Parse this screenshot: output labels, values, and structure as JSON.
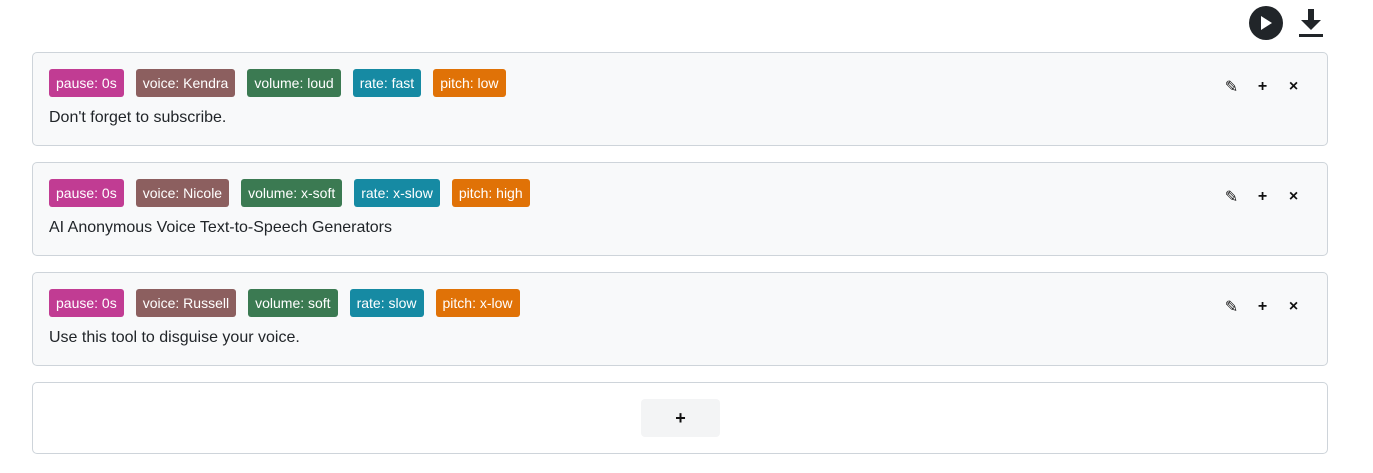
{
  "toolbar": {
    "play_icon": "play-icon",
    "download_icon": "download-icon"
  },
  "blocks": [
    {
      "tags": {
        "pause": "pause: 0s",
        "voice": "voice: Kendra",
        "volume": "volume: loud",
        "rate": "rate: fast",
        "pitch": "pitch: low"
      },
      "text": "Don't forget to subscribe."
    },
    {
      "tags": {
        "pause": "pause: 0s",
        "voice": "voice: Nicole",
        "volume": "volume: x-soft",
        "rate": "rate: x-slow",
        "pitch": "pitch: high"
      },
      "text": "AI Anonymous Voice Text-to-Speech Generators"
    },
    {
      "tags": {
        "pause": "pause: 0s",
        "voice": "voice: Russell",
        "volume": "volume: soft",
        "rate": "rate: slow",
        "pitch": "pitch: x-low"
      },
      "text": "Use this tool to disguise your voice."
    }
  ],
  "actions": {
    "edit": "✎",
    "add": "+",
    "remove": "×"
  },
  "add_block": {
    "label": "+"
  },
  "colors": {
    "pause": "#c13c93",
    "voice": "#8c5f5f",
    "volume": "#3b7a52",
    "rate": "#168aa3",
    "pitch": "#e07207"
  }
}
